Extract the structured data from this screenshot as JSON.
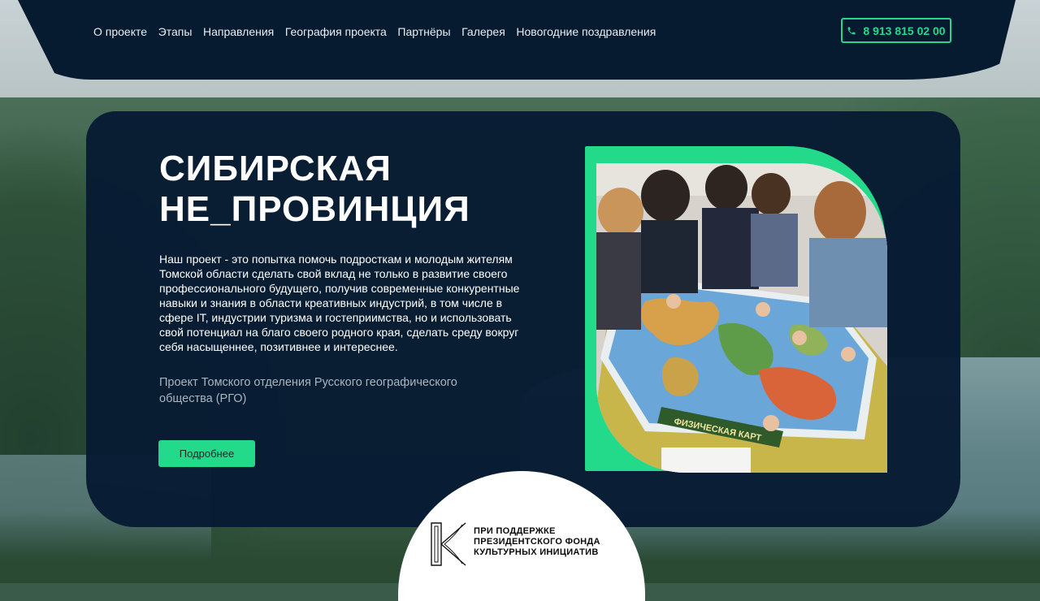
{
  "header": {
    "nav": [
      "О проекте",
      "Этапы",
      "Направления",
      "География проекта",
      "Партнёры",
      "Галерея",
      "Новогодние поздравления"
    ],
    "phone": "8 913 815 02 00",
    "phone_icon": "phone-icon"
  },
  "hero": {
    "title_line1": "СИБИРСКАЯ",
    "title_line2": "НЕ_ПРОВИНЦИЯ",
    "description": "Наш проект - это попытка помочь подросткам и молодым жителям Томской области сделать свой вклад не только в развитие своего профессионального будущего, получив современные конкурентные навыки и знания в области креативных индустрий, в том числе в сфере IT, индустрии туризма и гостеприимства, но и использовать свой потенциал на благо своего родного края, сделать среду вокруг себя насыщеннее, позитивнее и интереснее.",
    "subdescription": "Проект Томского отделения Русского географического общества (РГО)",
    "more_button": "Подробнее",
    "photo_caption": "ФИЗИЧЕСКАЯ КАРТ"
  },
  "sponsor": {
    "line1": "ПРИ ПОДДЕРЖКЕ",
    "line2": "ПРЕЗИДЕНТСКОГО ФОНДА",
    "line3": "КУЛЬТУРНЫХ ИНИЦИАТИВ",
    "logo_icon": "pfki-logo-icon"
  },
  "colors": {
    "accent": "#23d98a",
    "panel": "#071b33",
    "header": "#061a30"
  }
}
